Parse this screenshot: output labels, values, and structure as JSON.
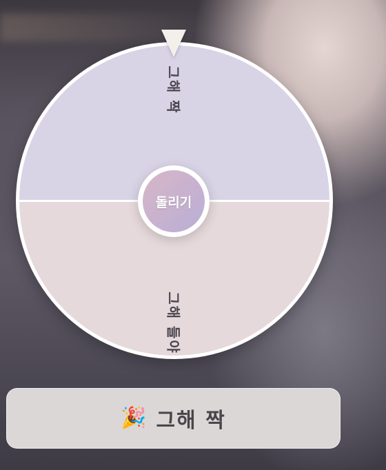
{
  "wheel": {
    "segments": [
      {
        "label": "그해 짝",
        "color": "#d9d3e6"
      },
      {
        "label": "그해 들야",
        "color": "#e6d9db"
      }
    ],
    "spin_label": "돌리기"
  },
  "result": {
    "icon": "party-popper-icon",
    "icon_glyph": "🎉",
    "text": "그해 짝"
  }
}
